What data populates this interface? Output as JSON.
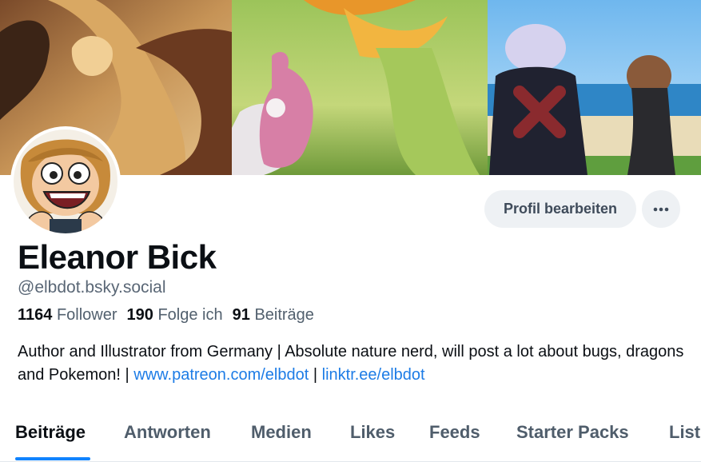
{
  "profile": {
    "display_name": "Eleanor Bick",
    "handle": "@elbdot.bsky.social",
    "stats": [
      {
        "count": "1164",
        "label": "Follower"
      },
      {
        "count": "190",
        "label": "Folge ich"
      },
      {
        "count": "91",
        "label": "Beiträge"
      }
    ],
    "bio": {
      "text": "Author and Illustrator from Germany | Absolute nature nerd, will post a lot about bugs, dragons and Pokemon! | ",
      "link1": "www.patreon.com/elbdot",
      "separator": " | ",
      "link2": "linktr.ee/elbdot"
    }
  },
  "actions": {
    "edit_label": "Profil bearbeiten",
    "more_icon": "ellipsis-icon"
  },
  "tabs": [
    {
      "label": "Beiträge",
      "active": true
    },
    {
      "label": "Antworten"
    },
    {
      "label": "Medien"
    },
    {
      "label": "Likes"
    },
    {
      "label": "Feeds"
    },
    {
      "label": "Starter Packs"
    },
    {
      "label": "List"
    }
  ],
  "colors": {
    "accent": "#1083fe",
    "link": "#1d7ce6",
    "button_bg": "#eef1f4"
  }
}
